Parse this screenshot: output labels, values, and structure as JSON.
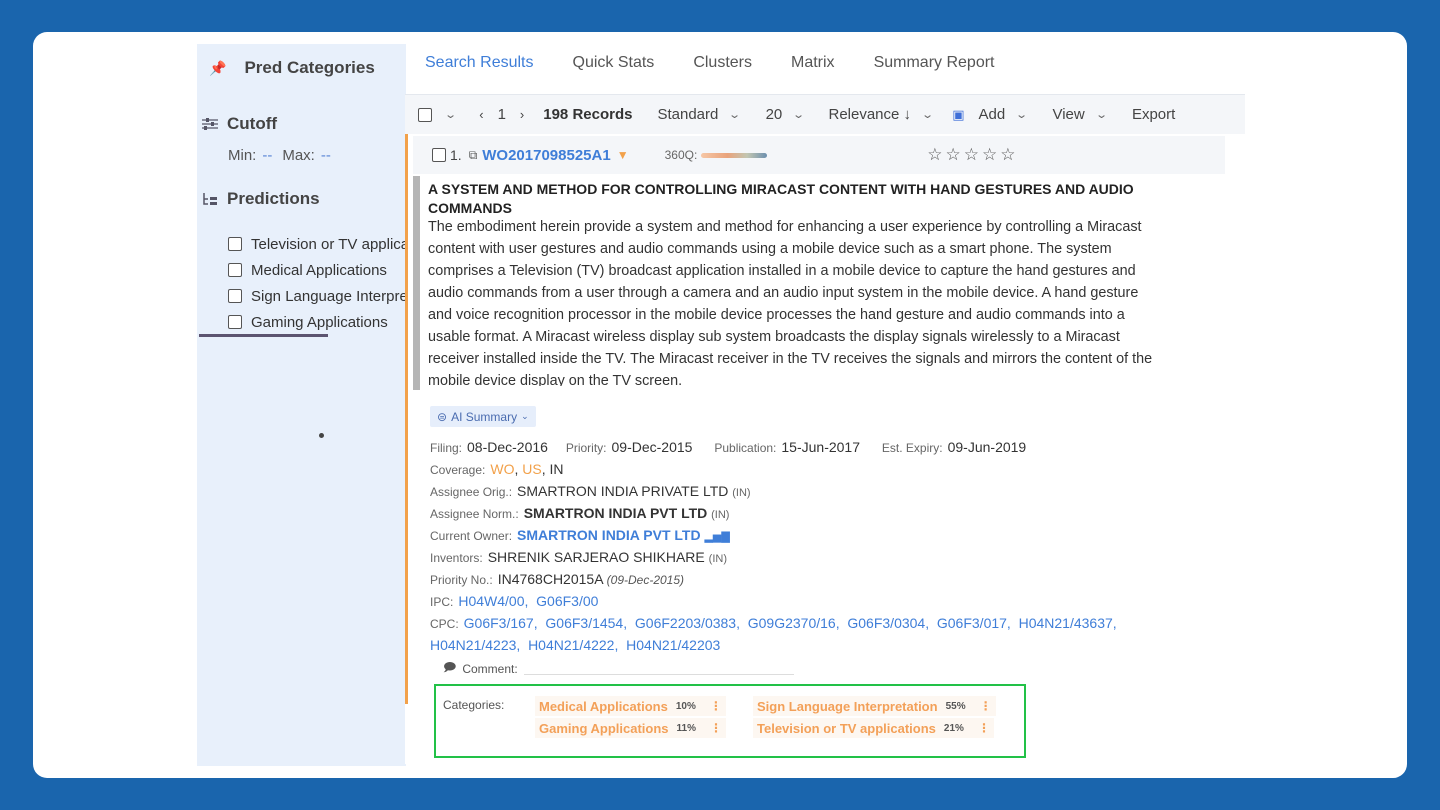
{
  "sidebar": {
    "title": "Pred Categories",
    "cutoff_label": "Cutoff",
    "min_label": "Min:",
    "min_value": "--",
    "max_label": "Max:",
    "max_value": "--",
    "predictions_label": "Predictions",
    "predictions": [
      "Television or TV applications",
      "Medical Applications",
      "Sign Language Interpretation",
      "Gaming Applications"
    ]
  },
  "tabs": [
    "Search Results",
    "Quick Stats",
    "Clusters",
    "Matrix",
    "Summary Report"
  ],
  "toolbar": {
    "page": "1",
    "records": "198 Records",
    "view_mode": "Standard",
    "per_page": "20",
    "sort": "Relevance ↓",
    "add": "Add",
    "view": "View",
    "export": "Export"
  },
  "result": {
    "index": "1.",
    "pub_number": "WO2017098525A1",
    "quality_label": "360Q:",
    "stars": "☆☆☆☆☆",
    "title": "A SYSTEM AND METHOD FOR CONTROLLING MIRACAST CONTENT WITH HAND GESTURES AND AUDIO COMMANDS",
    "abstract_lines": [
      "The embodiment herein provide a system and method for enhancing a user experience by controlling a Miracast",
      "content with user gestures and audio commands using a mobile device such as a smart phone. The system",
      "comprises a Television (TV) broadcast application installed in a mobile device to capture the hand gestures and",
      "audio commands from a user through a camera and an audio input system in the mobile device. A hand gesture",
      "and voice recognition processor in the mobile device processes the hand gesture and audio commands into a",
      "usable format. A Miracast wireless display sub system broadcasts the display signals wirelessly to a Miracast",
      "receiver installed inside the TV. The Miracast receiver in the TV receives the signals and mirrors the content of the",
      "mobile device display on the TV screen."
    ],
    "ai_summary": "AI Summary",
    "filing_label": "Filing:",
    "filing": "08-Dec-2016",
    "priority_label": "Priority:",
    "priority": "09-Dec-2015",
    "publication_label": "Publication:",
    "publication": "15-Jun-2017",
    "expiry_label": "Est. Expiry:",
    "expiry": "09-Jun-2019",
    "coverage_label": "Coverage:",
    "coverage": [
      "WO",
      "US",
      "IN"
    ],
    "assignee_orig_label": "Assignee Orig.:",
    "assignee_orig": "SMARTRON INDIA PRIVATE LTD",
    "assignee_orig_cc": "(IN)",
    "assignee_norm_label": "Assignee Norm.:",
    "assignee_norm": "SMARTRON INDIA PVT LTD",
    "assignee_norm_cc": "(IN)",
    "owner_label": "Current Owner:",
    "owner": "SMARTRON INDIA PVT LTD",
    "inventors_label": "Inventors:",
    "inventors": "SHRENIK SARJERAO SHIKHARE",
    "inventors_cc": "(IN)",
    "priority_no_label": "Priority No.:",
    "priority_no": "IN4768CH2015A",
    "priority_no_date": "(09-Dec-2015)",
    "ipc_label": "IPC:",
    "ipc": "H04W4/00,  G06F3/00",
    "cpc_label": "CPC:",
    "cpc_line1": "G06F3/167,  G06F3/1454,  G06F2203/0383,  G09G2370/16,  G06F3/0304,  G06F3/017,  H04N21/43637,",
    "cpc_line2": "H04N21/4223,  H04N21/4222,  H04N21/42203",
    "comment_label": "Comment:",
    "categories_label": "Categories:",
    "categories": [
      {
        "name": "Medical Applications",
        "pct": "10%"
      },
      {
        "name": "Sign Language Interpretation",
        "pct": "55%"
      },
      {
        "name": "Gaming Applications",
        "pct": "11%"
      },
      {
        "name": "Television or TV applications",
        "pct": "21%"
      }
    ]
  },
  "colors": {
    "page_bg": "#1a65ad",
    "accent_blue": "#3f7ed8",
    "accent_orange": "#f2a14a",
    "highlight_green": "#22c147"
  }
}
